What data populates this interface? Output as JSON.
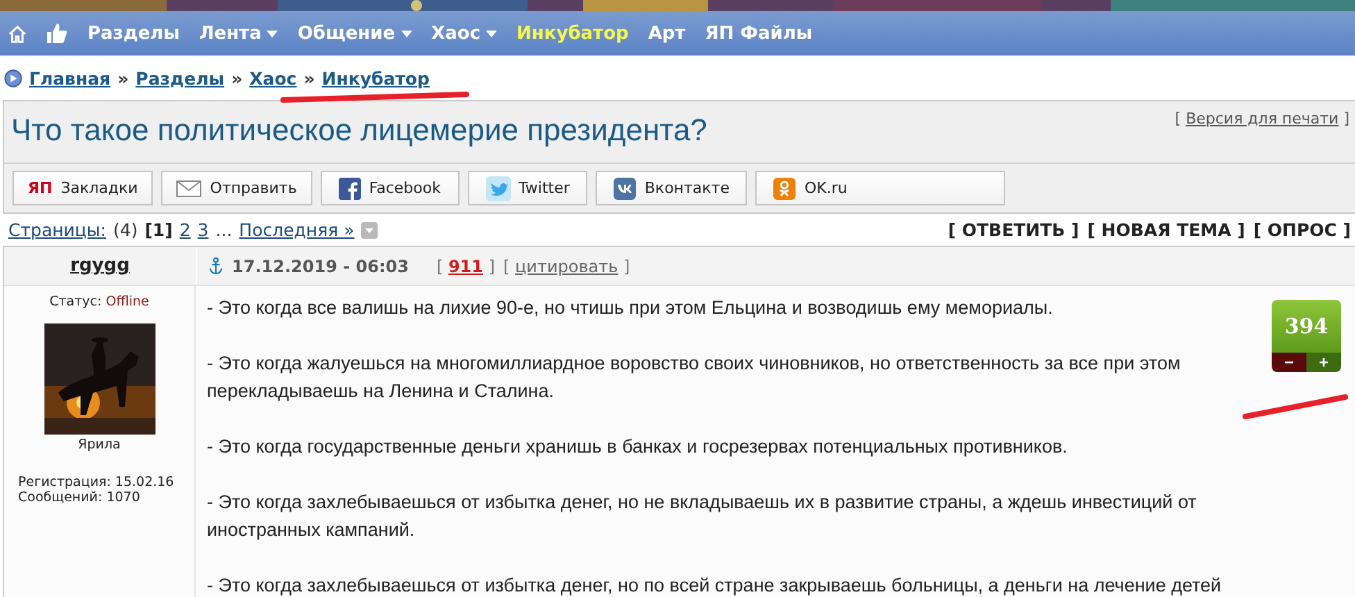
{
  "top_banner": {
    "kind": "picture"
  },
  "nav": {
    "items": [
      {
        "label": "Разделы",
        "dropdown": false,
        "highlight": false
      },
      {
        "label": "Лента",
        "dropdown": true,
        "highlight": false
      },
      {
        "label": "Общение",
        "dropdown": true,
        "highlight": false
      },
      {
        "label": "Хаос",
        "dropdown": true,
        "highlight": false
      },
      {
        "label": "Инкубатор",
        "dropdown": false,
        "highlight": true
      },
      {
        "label": "Арт",
        "dropdown": false,
        "highlight": false
      },
      {
        "label": "ЯП Файлы",
        "dropdown": false,
        "highlight": false
      }
    ]
  },
  "breadcrumb": [
    "Главная",
    "Разделы",
    "Хаос",
    "Инкубатор"
  ],
  "breadcrumb_separator": "»",
  "topic": {
    "title": "Что такое политическое лицемерие президента?",
    "print_link": "Версия для печати",
    "bracket_open": "[",
    "bracket_close": "]"
  },
  "share_buttons": [
    {
      "kind": "yap",
      "label": "Закладки",
      "icon_text": "ЯП"
    },
    {
      "kind": "mail",
      "label": "Отправить"
    },
    {
      "kind": "facebook",
      "label": "Facebook"
    },
    {
      "kind": "twitter",
      "label": "Twitter"
    },
    {
      "kind": "vk",
      "label": "Вконтакте"
    },
    {
      "kind": "ok",
      "label": "OK.ru"
    }
  ],
  "pagination": {
    "label": "Страницы:",
    "count": "(4)",
    "pages": [
      {
        "label": "[1]",
        "selected": true
      },
      {
        "label": "2",
        "selected": false
      },
      {
        "label": "3",
        "selected": false
      }
    ],
    "ellipsis": "...",
    "last": "Последняя »"
  },
  "actions": [
    "[ ОТВЕТИТЬ ]",
    "[ НОВАЯ ТЕМА ]",
    "[ ОПРОС ]"
  ],
  "post": {
    "author": "rgygg",
    "date": "17.12.2019 - 06:03",
    "number": "911",
    "quote": "цитировать",
    "bracket_open": "[",
    "bracket_close": "]",
    "status_label": "Статус:",
    "status": "Offline",
    "avatar": {
      "kind": "picture"
    },
    "avatar_caption": "Ярила",
    "registration": "Регистрация: 15.02.16",
    "messages": "Сообщений: 1070",
    "rating": {
      "value": "394",
      "minus": "−",
      "plus": "+"
    },
    "paragraphs": [
      "- Это когда все валишь на лихие 90-е, но чтишь при этом Ельцина и возводишь ему мемориалы.",
      "- Это когда жалуешься на многомиллиардное воровство своих чиновников, но ответственность за все при этом перекладываешь на Ленина и Сталина.",
      "- Это когда государственные деньги хранишь в банках и госрезервах потенциальных противников.",
      "- Это когда захлебываешься от избытка денег, но не вкладываешь их в развитие страны, а ждешь инвестиций от иностранных кампаний.",
      "- Это когда захлебываешься от избытка денег, но по всей стране закрываешь больницы, а деньги на лечение детей"
    ]
  }
}
